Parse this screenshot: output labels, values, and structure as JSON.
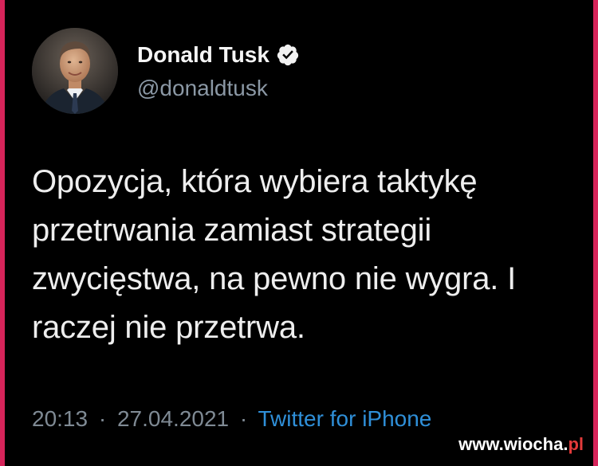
{
  "tweet": {
    "author": {
      "display_name": "Donald Tusk",
      "handle": "@donaldtusk",
      "verified": true,
      "verified_icon": "verified-badge-icon",
      "avatar": "profile-photo"
    },
    "text_lines": [
      "Opozycja, która wybiera taktykę",
      "przetrwania zamiast strategii",
      "zwycięstwa, na pewno nie wygra. I",
      "raczej nie przetrwa."
    ],
    "time": "20:13",
    "date": "27.04.2021",
    "separator": "·",
    "source": "Twitter for iPhone"
  },
  "watermark": {
    "main": "www.wiocha.",
    "tld": "pl"
  },
  "colors": {
    "background": "#000000",
    "edge": "#d6245a",
    "text": "#eeeeee",
    "muted": "#7f8a94",
    "link": "#2f8fd8",
    "watermark_accent": "#e23a3a"
  }
}
